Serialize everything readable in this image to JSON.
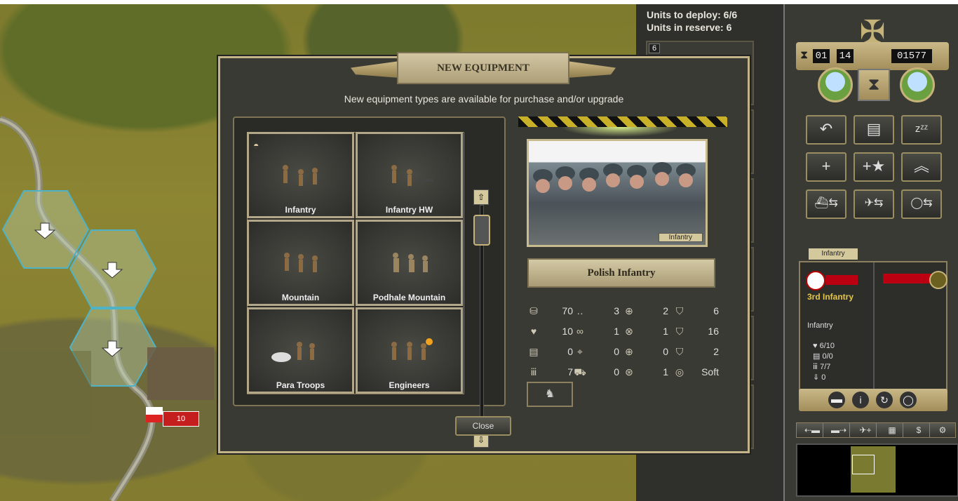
{
  "deploy": {
    "units_to_deploy": "Units to deploy: 6/6",
    "units_in_reserve": "Units in reserve: 6",
    "slot_number": "6"
  },
  "map": {
    "unit_strength": "10"
  },
  "control": {
    "turn_current": "01",
    "turn_total": "14",
    "prestige": "01577",
    "unit_tab": "Infantry",
    "unit_name": "3rd Infantry",
    "unit_type": "Infantry",
    "unit_stats": [
      "6/10",
      "0/0",
      "7/7",
      "0"
    ]
  },
  "dialog": {
    "title": "NEW EQUIPMENT",
    "subtitle": "New equipment types are available for purchase and/or upgrade",
    "units": [
      "Infantry",
      "Infantry HW",
      "Mountain",
      "Podhale Mountain",
      "Para Troops",
      "Engineers"
    ],
    "photo_label": "Infantry",
    "selected_unit": "Polish Infantry",
    "stats": [
      {
        "icon": "coins-icon",
        "value": "70"
      },
      {
        "icon": "footsteps-icon",
        "value": "3"
      },
      {
        "icon": "soft-attack-icon",
        "value": "2"
      },
      {
        "icon": "ground-defense-icon",
        "value": "6"
      },
      {
        "icon": "heart-icon",
        "value": "10"
      },
      {
        "icon": "binoculars-icon",
        "value": "1"
      },
      {
        "icon": "hard-attack-icon",
        "value": "1"
      },
      {
        "icon": "air-defense-icon",
        "value": "16"
      },
      {
        "icon": "fuel-icon",
        "value": "0"
      },
      {
        "icon": "range-icon",
        "value": "0"
      },
      {
        "icon": "air-attack-icon",
        "value": "0"
      },
      {
        "icon": "close-defense-icon",
        "value": "2"
      },
      {
        "icon": "ammo-icon",
        "value": "7"
      },
      {
        "icon": "transport-icon",
        "value": "0"
      },
      {
        "icon": "naval-attack-icon",
        "value": "1"
      },
      {
        "icon": "target-type-icon",
        "value": "Soft"
      }
    ],
    "close_label": "Close"
  },
  "colors": {
    "accent_gold": "#c3b48a",
    "panel_dark": "#3a3a35",
    "hex_highlight": "#4fb3c8"
  }
}
